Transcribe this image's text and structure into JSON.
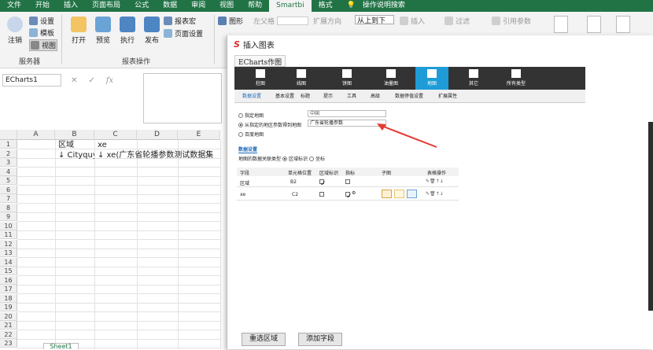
{
  "menubar": [
    "文件",
    "开始",
    "插入",
    "页面布局",
    "公式",
    "数据",
    "审阅",
    "视图",
    "帮助",
    "Smartbi",
    "格式",
    "操作说明搜索"
  ],
  "ribbon": {
    "logout": "注销",
    "settings": "设置",
    "template": "模板",
    "view": "视图",
    "group_server": "服务器",
    "open": "打开",
    "preview": "预览",
    "execute": "执行",
    "publish": "发布",
    "report_macro": "报表宏",
    "page_setup": "页面设置",
    "group_report": "报表操作",
    "shape": "图形",
    "left_grid": "左父格",
    "expand_dir": "扩展方向",
    "expand_value": "从上到下",
    "insert": "插入",
    "filter": "过滤",
    "ref_param": "引用参数"
  },
  "formula": {
    "namebox": "ECharts1",
    "cancel": "✕",
    "confirm": "✓",
    "fx": "fx"
  },
  "grid": {
    "cols": [
      "A",
      "B",
      "C",
      "D",
      "E"
    ],
    "rows": [
      "1",
      "2",
      "3",
      "4",
      "5",
      "6",
      "7",
      "8",
      "9",
      "10",
      "11",
      "12",
      "13",
      "14",
      "15",
      "16",
      "17",
      "18",
      "19",
      "20",
      "21",
      "22",
      "23"
    ],
    "b1": "区域",
    "c1": "xe",
    "b2": "↓ Cityquy(",
    "c2": "↓ xe(广东省轮播参数测试数据集"
  },
  "sheet_tab": "Sheet1",
  "dialog": {
    "title": "插入图表",
    "inner_title": "ECharts作图",
    "chart_types": [
      "柱图",
      "线图",
      "饼图",
      "油量图",
      "地图",
      "其它",
      "所有类型"
    ],
    "subtabs": [
      "数据设置",
      "基本设置",
      "标题",
      "提示",
      "工具",
      "高级",
      "数据停值设置",
      "扩展属性"
    ],
    "opt_fixed_map": "指定地图",
    "fixed_map_value": "中国",
    "opt_param_map": "从指定的地区参数得到地图",
    "param_map_value": "广东省轮播参数",
    "opt_baidu": "百度地图",
    "section_data": "数据设置",
    "map_type_label": "地图的数据关联类型",
    "map_type_region": "区域标识",
    "map_type_coord": "坐标",
    "table_headers": [
      "字段",
      "单元格位置",
      "区域标识",
      "指标",
      "子图",
      "表格操作"
    ],
    "rows": [
      {
        "field": "区域",
        "cell": "B2"
      },
      {
        "field": "xe",
        "cell": "C2"
      }
    ],
    "btn_reselect": "重选区域",
    "btn_addfield": "添加字段"
  },
  "colors": {
    "excel_green": "#217346",
    "map_active": "#1e9cd7",
    "arrow": "#e53935"
  }
}
